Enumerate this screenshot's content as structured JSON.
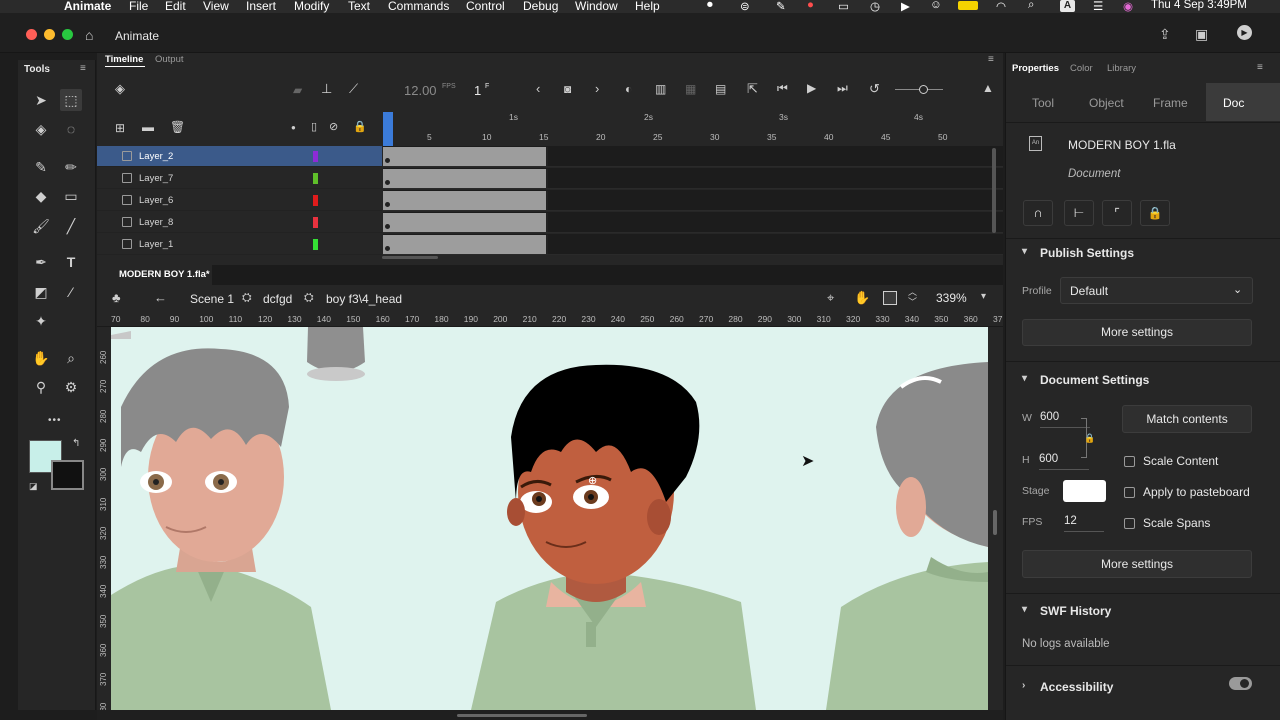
{
  "menubar": {
    "app_name": "Animate",
    "items": [
      "File",
      "Edit",
      "View",
      "Insert",
      "Modify",
      "Text",
      "Commands",
      "Control",
      "Debug",
      "Window",
      "Help"
    ],
    "clock": "Thu 4 Sep  3:49PM",
    "input_letter": "A"
  },
  "titlebar": {
    "tab_label": "Animate"
  },
  "tools_panel": {
    "title": "Tools",
    "more_label": "•••"
  },
  "timeline": {
    "tab_timeline": "Timeline",
    "tab_output": "Output",
    "fps": "12.00",
    "fps_unit": "FPS",
    "frame": "1",
    "frame_unit": "F",
    "ruler_seconds": [
      "1s",
      "2s",
      "3s",
      "4s"
    ],
    "ruler_frames": [
      "5",
      "10",
      "15",
      "20",
      "25",
      "30",
      "35",
      "40",
      "45",
      "50"
    ],
    "layers": [
      {
        "name": "Layer_2",
        "color": "#8e2bd6",
        "selected": true
      },
      {
        "name": "Layer_7",
        "color": "#5fbf2a",
        "selected": false
      },
      {
        "name": "Layer_6",
        "color": "#e01c1c",
        "selected": false
      },
      {
        "name": "Layer_8",
        "color": "#e8323f",
        "selected": false
      },
      {
        "name": "Layer_1",
        "color": "#35e035",
        "selected": false
      }
    ]
  },
  "document": {
    "tab_label": "MODERN BOY 1.fla*",
    "breadcrumb": [
      "Scene 1",
      "dcfgd",
      "boy f3\\4_head"
    ],
    "zoom": "339%",
    "h_ruler": [
      "70",
      "80",
      "90",
      "100",
      "110",
      "120",
      "130",
      "140",
      "150",
      "160",
      "170",
      "180",
      "190",
      "200",
      "210",
      "220",
      "230",
      "240",
      "250",
      "260",
      "270",
      "280",
      "290",
      "300",
      "310",
      "320",
      "330",
      "340",
      "350",
      "360",
      "37"
    ],
    "v_ruler": [
      "260",
      "270",
      "280",
      "290",
      "300",
      "310",
      "320",
      "330",
      "340",
      "350",
      "360",
      "370",
      "380"
    ]
  },
  "properties": {
    "tabs": [
      "Properties",
      "Color",
      "Library"
    ],
    "subtabs": [
      "Tool",
      "Object",
      "Frame",
      "Doc"
    ],
    "file_name": "MODERN BOY 1.fla",
    "file_kind": "Document",
    "publish": {
      "title": "Publish Settings",
      "profile_label": "Profile",
      "profile_value": "Default",
      "more_settings": "More settings"
    },
    "doc_settings": {
      "title": "Document Settings",
      "w_label": "W",
      "w_value": "600",
      "h_label": "H",
      "h_value": "600",
      "match_contents": "Match contents",
      "scale_content": "Scale Content",
      "stage_label": "Stage",
      "stage_color": "#ffffff",
      "apply_pasteboard": "Apply to pasteboard",
      "fps_label": "FPS",
      "fps_value": "12",
      "scale_spans": "Scale Spans",
      "more_settings": "More settings"
    },
    "swf_history": {
      "title": "SWF History",
      "empty": "No logs available"
    },
    "accessibility": {
      "title": "Accessibility"
    }
  },
  "colors": {
    "stage_bg": "#dff3ee",
    "fill_swatch": "#c8efe9",
    "selection_blue": "#3b5a8a"
  }
}
